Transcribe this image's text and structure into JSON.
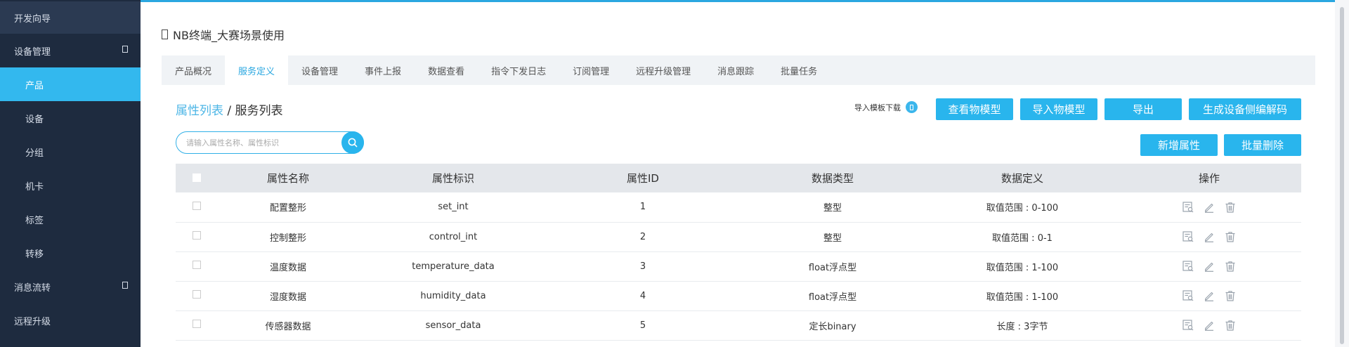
{
  "sidebar": {
    "items": [
      {
        "label": "开发向导"
      },
      {
        "label": "设备管理"
      },
      {
        "label": "产品"
      },
      {
        "label": "设备"
      },
      {
        "label": "分组"
      },
      {
        "label": "机卡"
      },
      {
        "label": "标签"
      },
      {
        "label": "转移"
      },
      {
        "label": "消息流转"
      },
      {
        "label": "远程升级"
      }
    ]
  },
  "page": {
    "title": "NB终端_大赛场景使用"
  },
  "tabs": [
    {
      "label": "产品概况"
    },
    {
      "label": "服务定义"
    },
    {
      "label": "设备管理"
    },
    {
      "label": "事件上报"
    },
    {
      "label": "数据查看"
    },
    {
      "label": "指令下发日志"
    },
    {
      "label": "订阅管理"
    },
    {
      "label": "远程升级管理"
    },
    {
      "label": "消息跟踪"
    },
    {
      "label": "批量任务"
    }
  ],
  "breadcrumb": {
    "link": "属性列表",
    "separator": " / ",
    "current": "服务列表"
  },
  "toolbar": {
    "import_template_label": "导入模板下载",
    "view_model": "查看物模型",
    "import_model": "导入物模型",
    "export": "导出",
    "gen_codec": "生成设备侧编解码",
    "add_attr": "新增属性",
    "batch_delete": "批量删除"
  },
  "search": {
    "placeholder": "请输入属性名称、属性标识"
  },
  "table": {
    "headers": [
      "属性名称",
      "属性标识",
      "属性ID",
      "数据类型",
      "数据定义",
      "操作"
    ],
    "rows": [
      {
        "name": "配置整形",
        "key": "set_int",
        "id": "1",
        "type": "整型",
        "def": "取值范围 : 0-100"
      },
      {
        "name": "控制整形",
        "key": "control_int",
        "id": "2",
        "type": "整型",
        "def": "取值范围 : 0-1"
      },
      {
        "name": "温度数据",
        "key": "temperature_data",
        "id": "3",
        "type": "float浮点型",
        "def": "取值范围 : 1-100"
      },
      {
        "name": "湿度数据",
        "key": "humidity_data",
        "id": "4",
        "type": "float浮点型",
        "def": "取值范围 : 1-100"
      },
      {
        "name": "传感器数据",
        "key": "sensor_data",
        "id": "5",
        "type": "定长binary",
        "def": "长度 : 3字节"
      }
    ]
  },
  "colors": {
    "accent": "#29b5ed",
    "sidebar_bg": "#1e2b3f",
    "sidebar_active": "#33b8ee"
  }
}
